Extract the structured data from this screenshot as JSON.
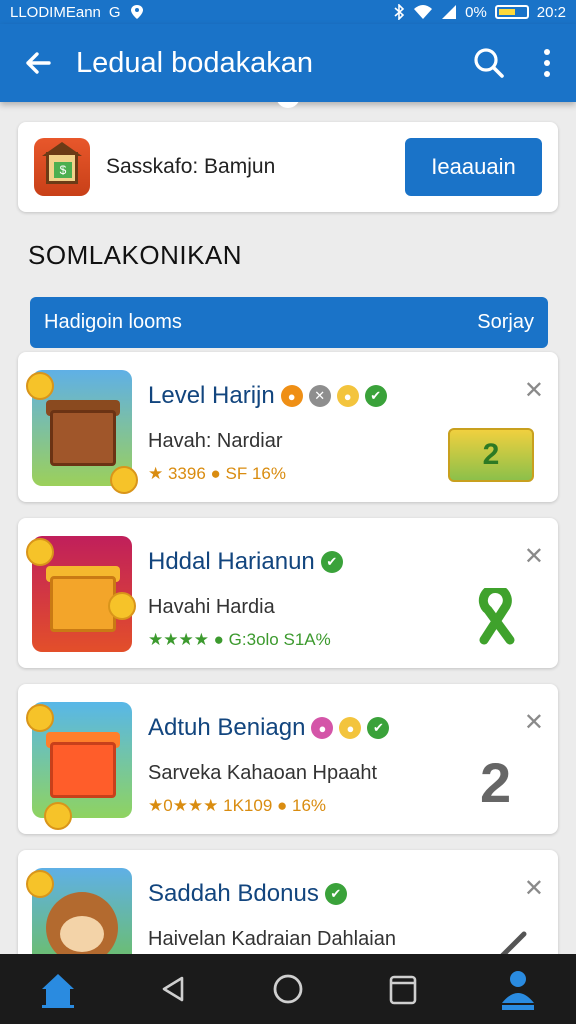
{
  "status": {
    "carrier": "LLODIMEann",
    "g": "G",
    "battery": "0%",
    "time": "20:2"
  },
  "appbar": {
    "title": "Ledual bodakakan"
  },
  "promo": {
    "label": "Sasskafo: Bamjun",
    "button": "Ieaauain"
  },
  "section": {
    "title": "SOMLAKONIKAN"
  },
  "filter": {
    "left": "Hadigoin looms",
    "right": "Sorjay"
  },
  "cards": [
    {
      "title": "Level Harijn",
      "sub": "Havah: Nardiar",
      "stats": "★ 3396 ● SF 16%",
      "stats_color": "#d98c10",
      "trail": "2"
    },
    {
      "title": "Hddal Harianun",
      "sub": "Havahi Hardia",
      "stats": "★★★★ ● G:3olo S1A%",
      "stats_color": "#3c9a2e",
      "trail": ""
    },
    {
      "title": "Adtuh Beniagn",
      "sub": "Sarveka Kahaoan Hpaaht",
      "stats": "★0★★★ 1K109 ● 16%",
      "stats_color": "#d98c10",
      "trail": "2"
    },
    {
      "title": "Saddah Bdonus",
      "sub": "Haivelan Kadraian Dahlaian",
      "stats": "",
      "stats_color": "#d98c10",
      "trail": ""
    }
  ],
  "colors": {
    "primary": "#1a73c8",
    "title": "#12457e",
    "check": "#3aa23a"
  },
  "icons": [
    "arrow-left-icon",
    "search-icon",
    "more-vert-icon",
    "close-icon",
    "check-badge-icon",
    "home-icon",
    "back-triangle-icon",
    "circle-home-icon",
    "recents-icon",
    "profile-icon"
  ]
}
